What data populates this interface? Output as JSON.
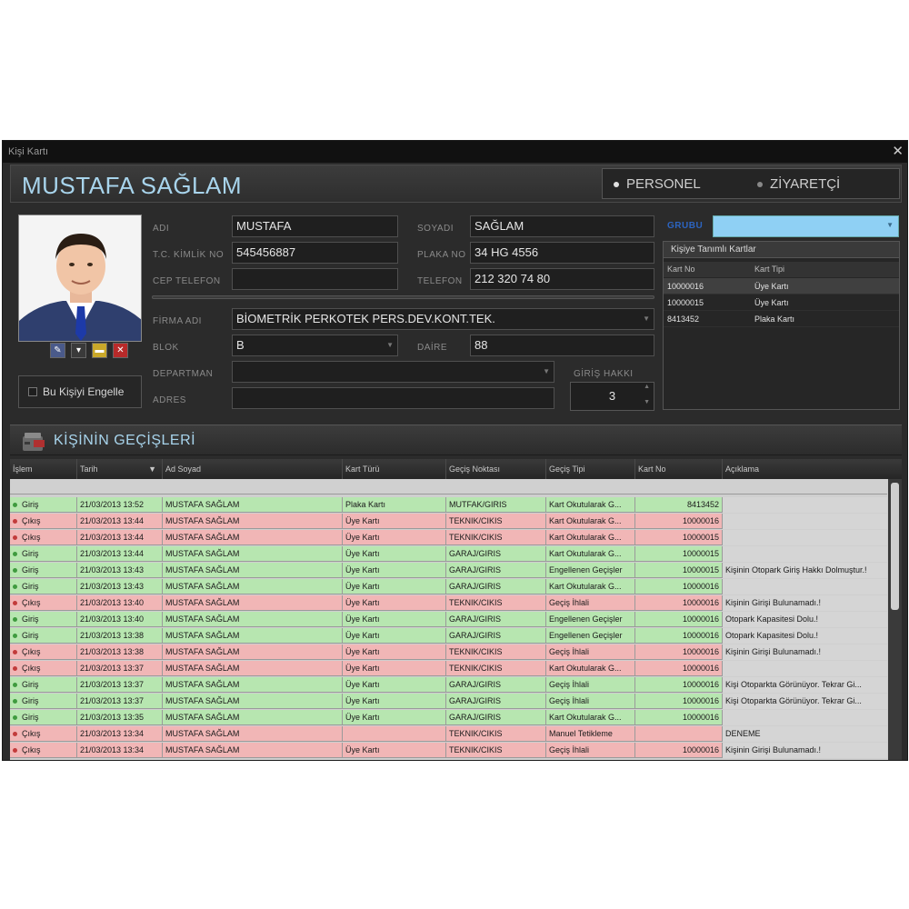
{
  "window": {
    "title": "Kişi Kartı",
    "close_glyph": "✕"
  },
  "header": {
    "name": "MUSTAFA SAĞLAM",
    "type_options": [
      "PERSONEL",
      "ZİYARETÇİ"
    ],
    "selected_type": "PERSONEL"
  },
  "photo_tools": [
    "edit-icon",
    "down-icon",
    "folder-icon",
    "delete-icon"
  ],
  "block_person": {
    "label": "Bu Kişiyi Engelle",
    "checked": false
  },
  "form": {
    "adi": {
      "label": "ADI",
      "value": "MUSTAFA"
    },
    "soyadi": {
      "label": "SOYADI",
      "value": "SAĞLAM"
    },
    "tc": {
      "label": "T.C. KİMLİK NO",
      "value": "545456887"
    },
    "plaka": {
      "label": "PLAKA NO",
      "value": "34 HG 4556"
    },
    "cep": {
      "label": "CEP TELEFON",
      "value": ""
    },
    "telefon": {
      "label": "TELEFON",
      "value": "212 320 74 80"
    },
    "firma": {
      "label": "FİRMA ADI",
      "value": "BİOMETRİK PERKOTEK PERS.DEV.KONT.TEK."
    },
    "blok": {
      "label": "BLOK",
      "value": "B"
    },
    "daire": {
      "label": "DAİRE",
      "value": "88"
    },
    "departman": {
      "label": "DEPARTMAN",
      "value": ""
    },
    "adres": {
      "label": "ADRES",
      "value": ""
    },
    "giris_hakki": {
      "label": "GİRİŞ HAKKI",
      "value": "3"
    }
  },
  "grubu": {
    "label": "GRUBU",
    "value": ""
  },
  "cards": {
    "title": "Kişiye Tanımlı Kartlar",
    "columns": [
      "Kart No",
      "Kart Tipi"
    ],
    "rows": [
      [
        "10000016",
        "Üye Kartı"
      ],
      [
        "10000015",
        "Üye Kartı"
      ],
      [
        "8413452",
        "Plaka Kartı"
      ]
    ]
  },
  "passes": {
    "title": "KİŞİNİN GEÇİŞLERİ",
    "sort_glyph": "▼",
    "columns": [
      "İşlem",
      "Tarih",
      "Ad Soyad",
      "Kart Türü",
      "Geçiş Noktası",
      "Geçiş Tipi",
      "Kart No",
      "Açıklama"
    ],
    "rows": [
      {
        "dir": "in",
        "islem": "Giriş",
        "tarih": "21/03/2013 13:52",
        "ad": "MUSTAFA SAĞLAM",
        "tur": "Plaka Kartı",
        "nokta": "MUTFAK/GIRIS",
        "tip": "Kart Okutularak G...",
        "kart": "8413452",
        "aciklama": ""
      },
      {
        "dir": "out",
        "islem": "Çıkış",
        "tarih": "21/03/2013 13:44",
        "ad": "MUSTAFA SAĞLAM",
        "tur": "Üye Kartı",
        "nokta": "TEKNIK/CIKIS",
        "tip": "Kart Okutularak G...",
        "kart": "10000016",
        "aciklama": ""
      },
      {
        "dir": "out",
        "islem": "Çıkış",
        "tarih": "21/03/2013 13:44",
        "ad": "MUSTAFA SAĞLAM",
        "tur": "Üye Kartı",
        "nokta": "TEKNIK/CIKIS",
        "tip": "Kart Okutularak G...",
        "kart": "10000015",
        "aciklama": ""
      },
      {
        "dir": "in",
        "islem": "Giriş",
        "tarih": "21/03/2013 13:44",
        "ad": "MUSTAFA SAĞLAM",
        "tur": "Üye Kartı",
        "nokta": "GARAJ/GIRIS",
        "tip": "Kart Okutularak G...",
        "kart": "10000015",
        "aciklama": ""
      },
      {
        "dir": "in",
        "islem": "Giriş",
        "tarih": "21/03/2013 13:43",
        "ad": "MUSTAFA SAĞLAM",
        "tur": "Üye Kartı",
        "nokta": "GARAJ/GIRIS",
        "tip": "Engellenen Geçişler",
        "kart": "10000015",
        "aciklama": "Kişinin Otopark Giriş Hakkı Dolmuştur.!"
      },
      {
        "dir": "in",
        "islem": "Giriş",
        "tarih": "21/03/2013 13:43",
        "ad": "MUSTAFA SAĞLAM",
        "tur": "Üye Kartı",
        "nokta": "GARAJ/GIRIS",
        "tip": "Kart Okutularak G...",
        "kart": "10000016",
        "aciklama": ""
      },
      {
        "dir": "out",
        "islem": "Çıkış",
        "tarih": "21/03/2013 13:40",
        "ad": "MUSTAFA SAĞLAM",
        "tur": "Üye Kartı",
        "nokta": "TEKNIK/CIKIS",
        "tip": "Geçiş İhlali",
        "kart": "10000016",
        "aciklama": "Kişinin Girişi Bulunamadı.!"
      },
      {
        "dir": "in",
        "islem": "Giriş",
        "tarih": "21/03/2013 13:40",
        "ad": "MUSTAFA SAĞLAM",
        "tur": "Üye Kartı",
        "nokta": "GARAJ/GIRIS",
        "tip": "Engellenen Geçişler",
        "kart": "10000016",
        "aciklama": "Otopark Kapasitesi Dolu.!"
      },
      {
        "dir": "in",
        "islem": "Giriş",
        "tarih": "21/03/2013 13:38",
        "ad": "MUSTAFA SAĞLAM",
        "tur": "Üye Kartı",
        "nokta": "GARAJ/GIRIS",
        "tip": "Engellenen Geçişler",
        "kart": "10000016",
        "aciklama": "Otopark Kapasitesi Dolu.!"
      },
      {
        "dir": "out",
        "islem": "Çıkış",
        "tarih": "21/03/2013 13:38",
        "ad": "MUSTAFA SAĞLAM",
        "tur": "Üye Kartı",
        "nokta": "TEKNIK/CIKIS",
        "tip": "Geçiş İhlali",
        "kart": "10000016",
        "aciklama": "Kişinin Girişi Bulunamadı.!"
      },
      {
        "dir": "out",
        "islem": "Çıkış",
        "tarih": "21/03/2013 13:37",
        "ad": "MUSTAFA SAĞLAM",
        "tur": "Üye Kartı",
        "nokta": "TEKNIK/CIKIS",
        "tip": "Kart Okutularak G...",
        "kart": "10000016",
        "aciklama": ""
      },
      {
        "dir": "in",
        "islem": "Giriş",
        "tarih": "21/03/2013 13:37",
        "ad": "MUSTAFA SAĞLAM",
        "tur": "Üye Kartı",
        "nokta": "GARAJ/GIRIS",
        "tip": "Geçiş İhlali",
        "kart": "10000016",
        "aciklama": "Kişi Otoparkta Görünüyor. Tekrar Gi..."
      },
      {
        "dir": "in",
        "islem": "Giriş",
        "tarih": "21/03/2013 13:37",
        "ad": "MUSTAFA SAĞLAM",
        "tur": "Üye Kartı",
        "nokta": "GARAJ/GIRIS",
        "tip": "Geçiş İhlali",
        "kart": "10000016",
        "aciklama": "Kişi Otoparkta Görünüyor. Tekrar Gi..."
      },
      {
        "dir": "in",
        "islem": "Giriş",
        "tarih": "21/03/2013 13:35",
        "ad": "MUSTAFA SAĞLAM",
        "tur": "Üye Kartı",
        "nokta": "GARAJ/GIRIS",
        "tip": "Kart Okutularak G...",
        "kart": "10000016",
        "aciklama": ""
      },
      {
        "dir": "out",
        "islem": "Çıkış",
        "tarih": "21/03/2013 13:34",
        "ad": "MUSTAFA SAĞLAM",
        "tur": "",
        "nokta": "TEKNIK/CIKIS",
        "tip": "Manuel Tetikleme",
        "kart": "",
        "aciklama": "DENEME"
      },
      {
        "dir": "out",
        "islem": "Çıkış",
        "tarih": "21/03/2013 13:34",
        "ad": "MUSTAFA SAĞLAM",
        "tur": "Üye Kartı",
        "nokta": "TEKNIK/CIKIS",
        "tip": "Geçiş İhlali",
        "kart": "10000016",
        "aciklama": "Kişinin Girişi Bulunamadı.!"
      }
    ]
  },
  "colors": {
    "accent": "#a8d4ec",
    "entry_row": "#b7e6b0",
    "exit_row": "#f1b6b6",
    "group_field": "#8fd0f4"
  }
}
